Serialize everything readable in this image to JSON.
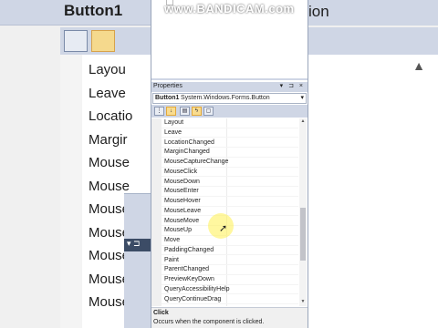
{
  "watermark": "www.BANDICAM.com",
  "background": {
    "title": "Button1",
    "right_title_fragment": "ion",
    "items": [
      "Layou",
      "Leave",
      "Locatio",
      "Margir",
      "Mouse",
      "Mouse",
      "Mouse",
      "Mouse",
      "Mouse",
      "Mouse",
      "Mouse",
      "Mouse"
    ]
  },
  "panel": {
    "title": "Properties",
    "controls": "▾ ⊐ ×",
    "object_name": "Button1",
    "object_type": "System.Windows.Forms.Button",
    "toolbar_icons": [
      "categorized-icon",
      "alphabetical-icon",
      "properties-icon",
      "events-icon",
      "property-pages-icon"
    ]
  },
  "events": [
    "Layout",
    "Leave",
    "LocationChanged",
    "MarginChanged",
    "MouseCaptureChange",
    "MouseClick",
    "MouseDown",
    "MouseEnter",
    "MouseHover",
    "MouseLeave",
    "MouseMove",
    "MouseUp",
    "Move",
    "PaddingChanged",
    "Paint",
    "ParentChanged",
    "PreviewKeyDown",
    "QueryAccessibilityHelp",
    "QueryContinueDrag"
  ],
  "description": {
    "heading": "Click",
    "text": "Occurs when the component is clicked."
  },
  "colors": {
    "chrome": "#cfd6e5",
    "active_toolbar": "#f9dc8f",
    "cursor_highlight": "#fff050"
  }
}
